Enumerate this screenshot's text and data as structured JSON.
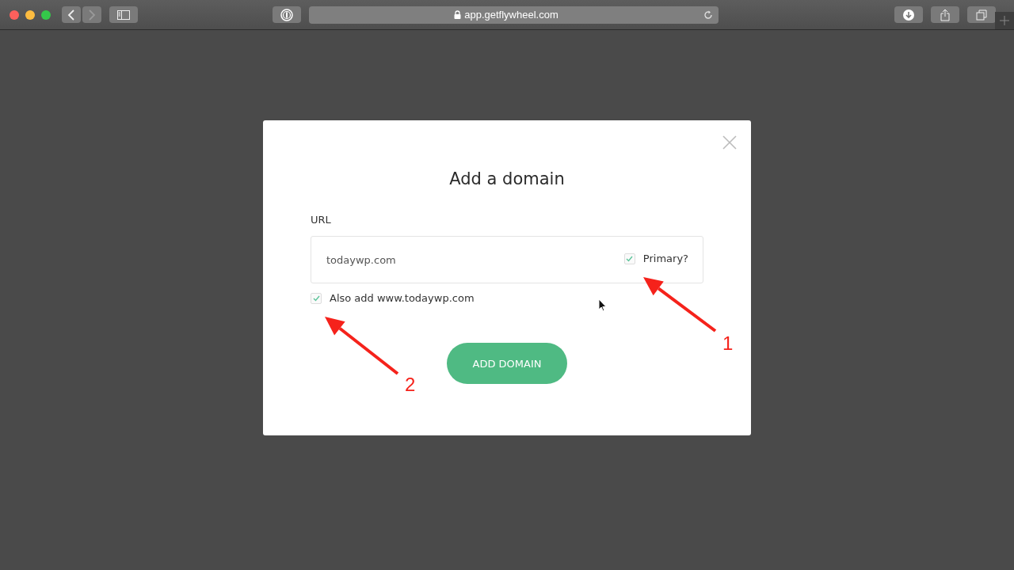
{
  "browser": {
    "address": "app.getflywheel.com"
  },
  "dialog": {
    "title": "Add a domain",
    "url_label": "URL",
    "url_field": {
      "value": "todaywp.com"
    },
    "options": [
      {
        "label": "Primary?",
        "checked": true
      },
      {
        "label": "Also add www.todaywp.com",
        "checked": true
      }
    ],
    "button": "ADD DOMAIN"
  },
  "annotations": [
    {
      "number": "1"
    },
    {
      "number": "2"
    }
  ]
}
